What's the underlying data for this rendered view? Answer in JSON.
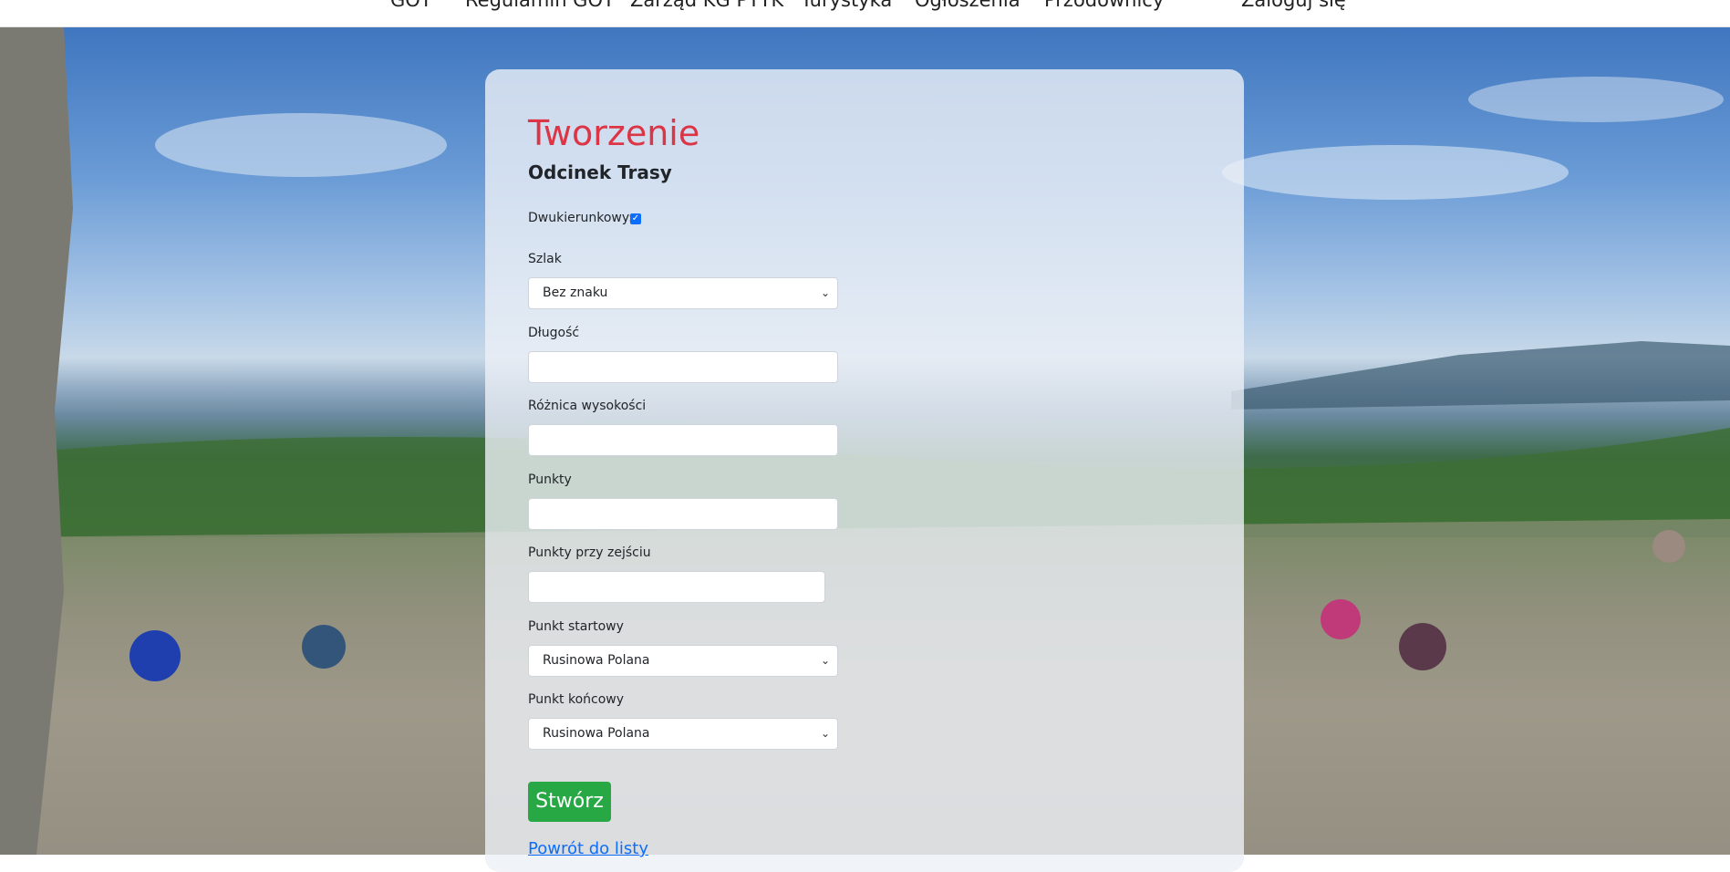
{
  "nav": {
    "items": [
      "GOT",
      "Regulamin GOT",
      "Zarząd KG PTTK",
      "Turystyka",
      "Ogłoszenia",
      "Przodownicy",
      "Zaloguj się"
    ]
  },
  "form": {
    "title": "Tworzenie",
    "subtitle": "Odcinek Trasy",
    "bidirectional_label": "Dwukierunkowy:",
    "bidirectional_checked": true,
    "trail_label": "Szlak",
    "trail_value": "Bez znaku",
    "length_label": "Długość",
    "length_value": "",
    "elevation_label": "Różnica wysokości",
    "elevation_value": "",
    "points_label": "Punkty",
    "points_value": "",
    "points_descent_label": "Punkty przy zejściu",
    "points_descent_value": "",
    "start_label": "Punkt startowy",
    "start_value": "Rusinowa Polana",
    "end_label": "Punkt końcowy",
    "end_value": "Rusinowa Polana",
    "submit_label": "Stwórz",
    "back_label": "Powrót do listy"
  },
  "colors": {
    "title": "#dc3545",
    "submit_bg": "#28a745",
    "link": "#0d6efd"
  }
}
